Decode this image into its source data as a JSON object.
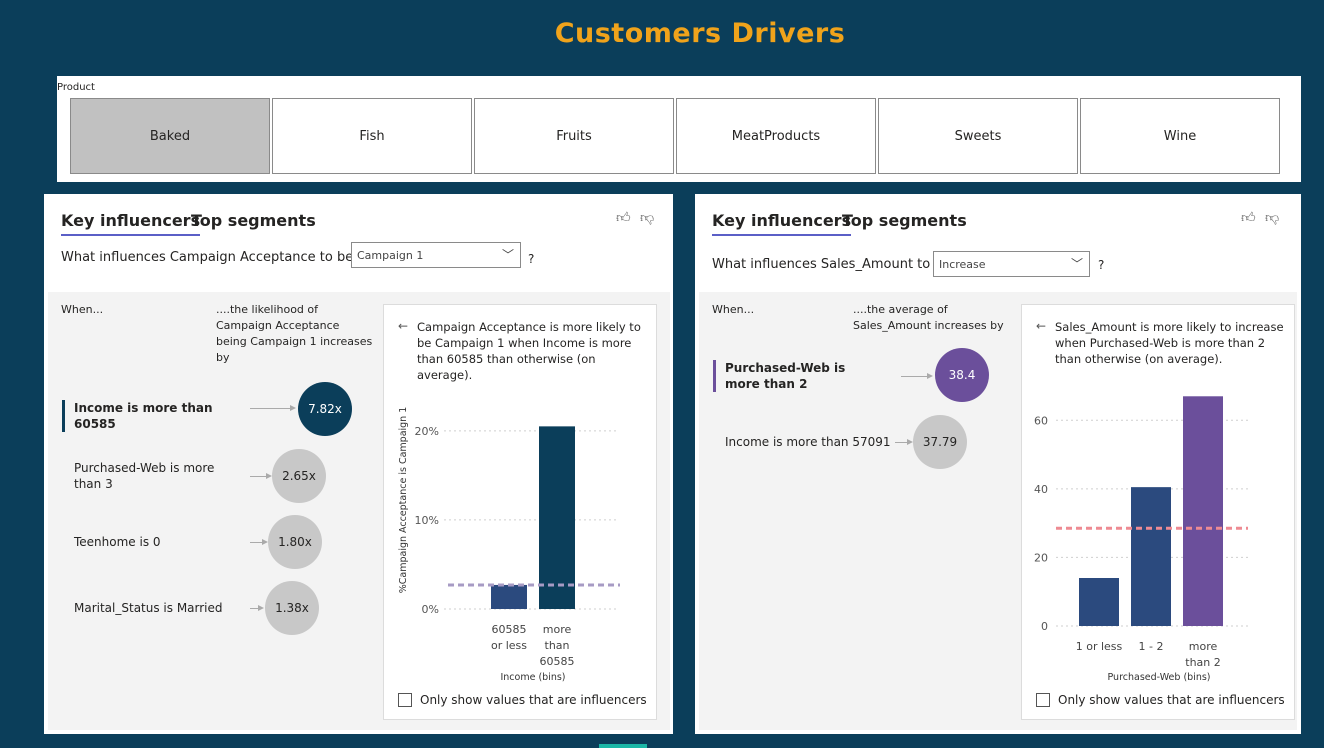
{
  "title": "Customers Drivers",
  "colors": {
    "background": "#0b3e5a",
    "title": "#f0a31b",
    "dark_bubble": "#0b3e5a",
    "purple_bubble": "#6b4f9b",
    "grey_bubble": "#c8c8c8",
    "bar_blue": "#2b4a7e",
    "bar_dark": "#0b3e5a",
    "bar_purple": "#6b4f9b"
  },
  "slicer": {
    "label": "Product",
    "options": [
      {
        "label": "Baked",
        "selected": true
      },
      {
        "label": "Fish",
        "selected": false
      },
      {
        "label": "Fruits",
        "selected": false
      },
      {
        "label": "MeatProducts",
        "selected": false
      },
      {
        "label": "Sweets",
        "selected": false
      },
      {
        "label": "Wine",
        "selected": false
      }
    ]
  },
  "left": {
    "tabs": [
      "Key influencers",
      "Top segments"
    ],
    "question": "What influences Campaign Acceptance to be",
    "dropdown_value": "Campaign 1",
    "qmark": "?",
    "when": "When...",
    "likelihood": [
      "....the likelihood of",
      "Campaign Acceptance",
      "being Campaign 1 increases",
      "by"
    ],
    "influencers": [
      {
        "label": "Income is more than 60585",
        "value": "7.82x",
        "bold": true
      },
      {
        "label": "Purchased-Web is more than 3",
        "value": "2.65x",
        "bold": false
      },
      {
        "label": "Teenhome is 0",
        "value": "1.80x",
        "bold": false
      },
      {
        "label": "Marital_Status is Married",
        "value": "1.38x",
        "bold": false
      }
    ],
    "detail": {
      "back": "←",
      "text": "Campaign Acceptance is more likely to be Campaign 1 when Income is more than 60585 than otherwise (on average).",
      "checkbox_label": "Only show values that are influencers"
    }
  },
  "right": {
    "tabs": [
      "Key influencers",
      "Top segments"
    ],
    "question": "What influences Sales_Amount to",
    "dropdown_value": "Increase",
    "qmark": "?",
    "when": "When...",
    "average": [
      "....the average of",
      "Sales_Amount increases by"
    ],
    "influencers": [
      {
        "label": "Purchased-Web is more than 2",
        "value": "38.4",
        "bold": true
      },
      {
        "label": "Income is more than 57091",
        "value": "37.79",
        "bold": false
      }
    ],
    "detail": {
      "back": "←",
      "text": "Sales_Amount is more likely to increase when Purchased-Web is more than 2 than otherwise (on average).",
      "checkbox_label": "Only show values that are influencers"
    }
  },
  "chart_data": [
    {
      "type": "bar",
      "categories": [
        [
          "60585",
          "or less"
        ],
        [
          "more",
          "than",
          "60585"
        ]
      ],
      "values": [
        2.7,
        20.5
      ],
      "reference_line": 2.7,
      "ylabel": "%Campaign Acceptance is Campaign 1",
      "xlabel": "Income (bins)",
      "ylim": [
        0,
        22
      ],
      "yticks": [
        "0%",
        "10%",
        "20%"
      ],
      "ytick_values": [
        0,
        10,
        20
      ],
      "grid": true
    },
    {
      "type": "bar",
      "categories": [
        [
          "1 or less"
        ],
        [
          "1 - 2"
        ],
        [
          "more",
          "than 2"
        ]
      ],
      "values": [
        14,
        40.5,
        67
      ],
      "reference_line": 28.5,
      "xlabel": "Purchased-Web (bins)",
      "ylim": [
        0,
        70
      ],
      "yticks": [
        "0",
        "20",
        "40",
        "60"
      ],
      "ytick_values": [
        0,
        20,
        40,
        60
      ],
      "grid": true
    }
  ]
}
